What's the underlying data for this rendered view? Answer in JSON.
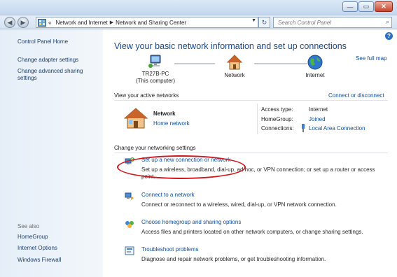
{
  "window": {
    "minimize_label": "—",
    "maximize_label": "▭",
    "close_label": "✕"
  },
  "nav": {
    "back_glyph": "◀",
    "forward_glyph": "▶",
    "overflow": "«",
    "breadcrumb": [
      "Network and Internet",
      "Network and Sharing Center"
    ],
    "refresh_glyph": "↻",
    "search_placeholder": "Search Control Panel"
  },
  "sidebar": {
    "items": [
      {
        "label": "Control Panel Home"
      },
      {
        "label": "Change adapter settings"
      },
      {
        "label": "Change advanced sharing settings"
      }
    ],
    "see_also_heading": "See also",
    "see_also": [
      {
        "label": "HomeGroup"
      },
      {
        "label": "Internet Options"
      },
      {
        "label": "Windows Firewall"
      }
    ]
  },
  "main": {
    "help_glyph": "?",
    "headline": "View your basic network information and set up connections",
    "see_full_map": "See full map",
    "map": {
      "computer_name": "TR27B-PC",
      "computer_sub": "(This computer)",
      "network": "Network",
      "internet": "Internet"
    },
    "active_heading": "View your active networks",
    "connect_disconnect": "Connect or disconnect",
    "active_network": {
      "name": "Network",
      "type_link": "Home network",
      "access_type_label": "Access type:",
      "access_type_value": "Internet",
      "homegroup_label": "HomeGroup:",
      "homegroup_value": "Joined",
      "connections_label": "Connections:",
      "connections_value": "Local Area Connection"
    },
    "settings_heading": "Change your networking settings",
    "tasks": [
      {
        "title": "Set up a new connection or network",
        "desc": "Set up a wireless, broadband, dial-up, ad hoc, or VPN connection; or set up a router or access point."
      },
      {
        "title": "Connect to a network",
        "desc": "Connect or reconnect to a wireless, wired, dial-up, or VPN network connection."
      },
      {
        "title": "Choose homegroup and sharing options",
        "desc": "Access files and printers located on other network computers, or change sharing settings."
      },
      {
        "title": "Troubleshoot problems",
        "desc": "Diagnose and repair network problems, or get troubleshooting information."
      }
    ]
  },
  "colors": {
    "link": "#0d4fa3",
    "headline": "#1b4a8e",
    "highlight_ellipse": "#d0181e",
    "sidebar_bg": "#e5eef8"
  }
}
